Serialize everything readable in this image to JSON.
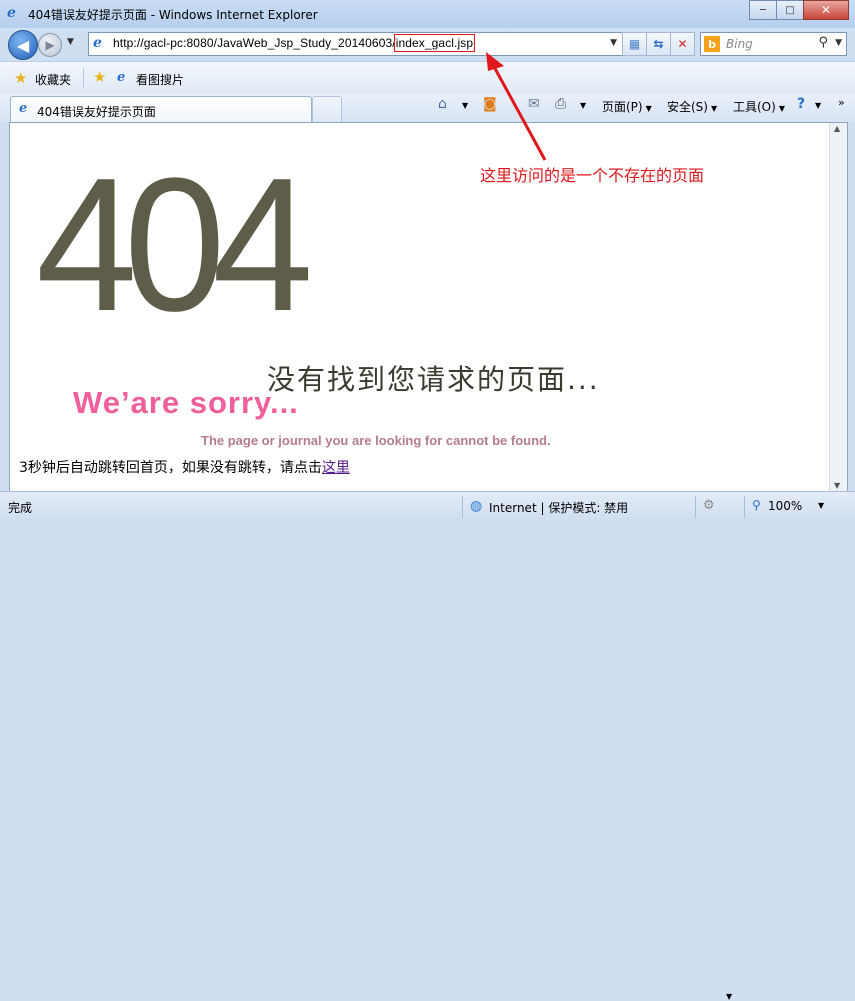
{
  "window": {
    "title": "404错误友好提示页面 - Windows Internet Explorer",
    "minimize": "─",
    "maximize": "□",
    "close": "✕"
  },
  "navbar": {
    "url_prefix": "http://gacl-pc:8080/JavaWeb_Jsp_Study_20140603/",
    "url_highlight": "index_gacl.jsp",
    "search_placeholder": "Bing"
  },
  "favorites": {
    "label": "收藏夹",
    "site_label": "看图搜片"
  },
  "tab": {
    "label": "404错误友好提示页面"
  },
  "commands": {
    "page": "页面(P)",
    "safety": "安全(S)",
    "tools": "工具(O)"
  },
  "content": {
    "big_code": "404",
    "not_found": "没有找到您请求的页面...",
    "sorry": "We’are sorry...",
    "journal": "The page or journal you are looking for cannot be found.",
    "redirect_text": "3秒钟后自动跳转回首页，如果没有跳转，请点击",
    "redirect_link": "这里"
  },
  "annotation": {
    "text": "这里访问的是一个不存在的页面",
    "color": "#e0171b"
  },
  "status": {
    "text": "完成",
    "zone": "Internet | 保护模式: 禁用",
    "zoom": "100%"
  }
}
